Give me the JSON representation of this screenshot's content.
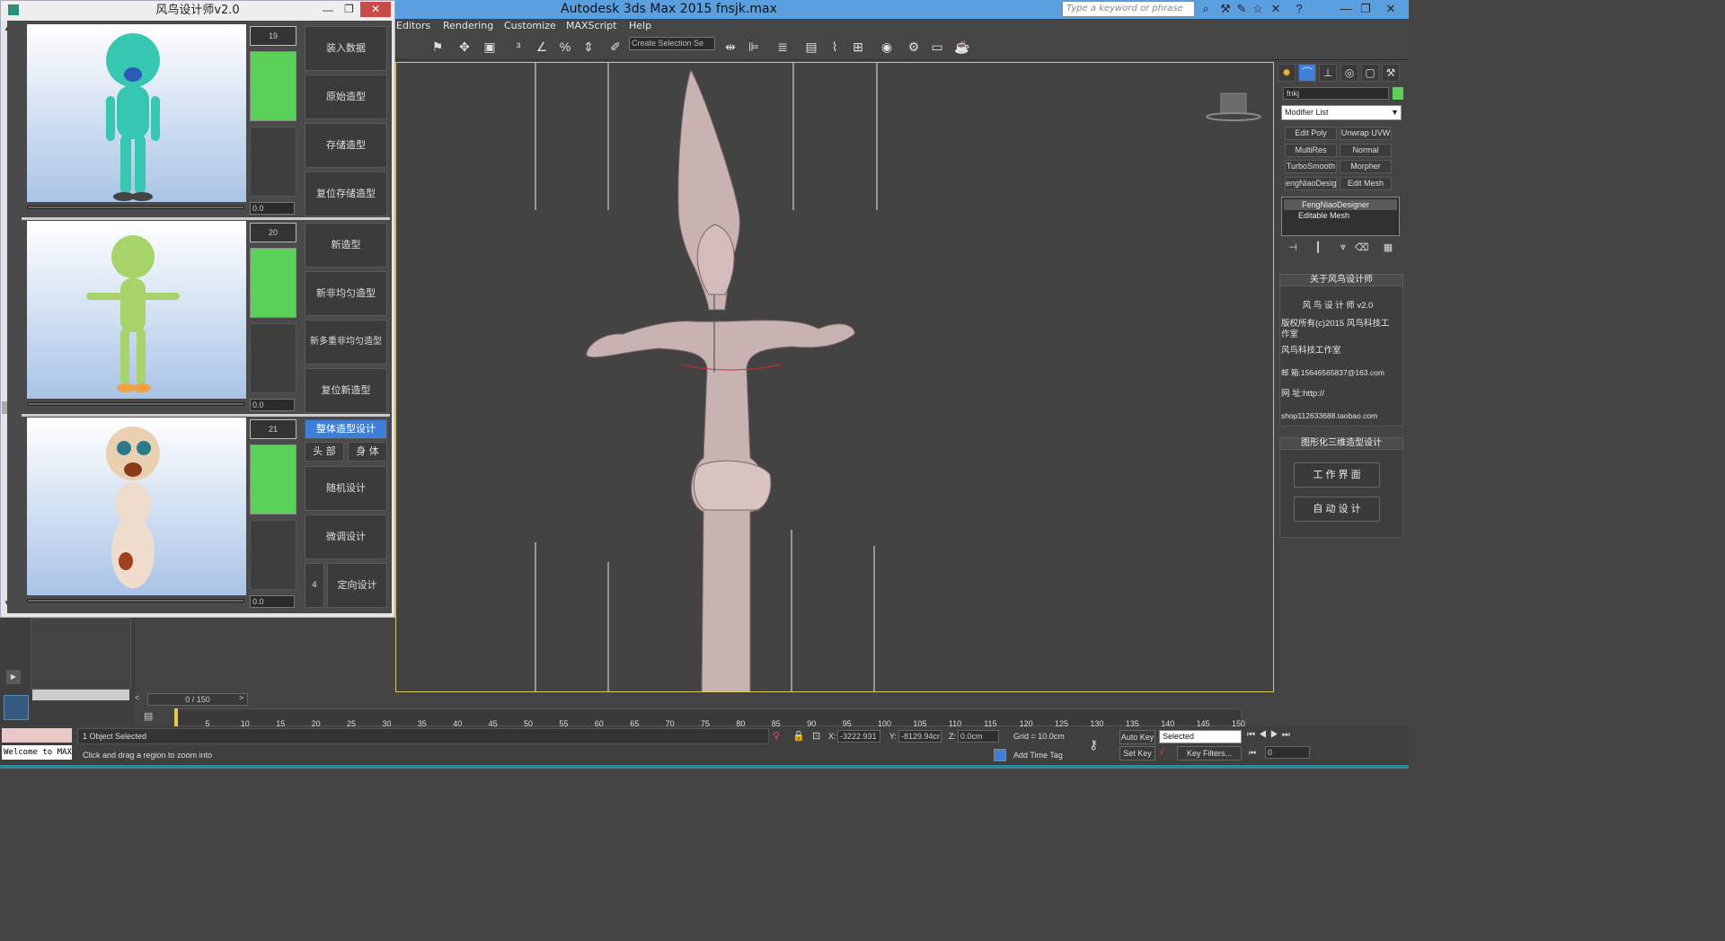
{
  "app": {
    "title": "Autodesk 3ds Max  2015     fnsjk.max",
    "search_placeholder": "Type a keyword or phrase",
    "menu": [
      "Editors",
      "Rendering",
      "Customize",
      "MAXScript",
      "Help"
    ],
    "selection_set_placeholder": "Create Selection Se"
  },
  "plugin": {
    "title": "风鸟设计师v2.0",
    "rows": [
      {
        "index": "19",
        "spin": "0.0",
        "buttons": [
          "装入数据",
          "原始造型",
          "存储造型",
          "复位存储造型"
        ]
      },
      {
        "index": "20",
        "spin": "0.0",
        "buttons": [
          "新造型",
          "新非均匀造型",
          "新多重非均匀造型",
          "复位新造型"
        ]
      },
      {
        "index": "21",
        "spin": "0.0",
        "active_button": "整体造型设计",
        "sub_buttons": [
          "头 部",
          "身 体"
        ],
        "buttons": [
          "随机设计",
          "微调设计"
        ],
        "directional_value": "4",
        "directional_button": "定向设计"
      }
    ],
    "colors": {
      "slot_green": "#5ad25a",
      "active_blue": "#3d7fd6"
    }
  },
  "right_panel": {
    "object_name": "fnkj",
    "object_color": "#5ad25a",
    "modifier_list": "Modifier List",
    "modifier_buttons": [
      "Edit Poly",
      "Unwrap UVW",
      "MultiRes",
      "Normal",
      "TurboSmooth",
      "Morpher",
      "engNiaoDesign",
      "Edit Mesh"
    ],
    "stack": [
      "FengNiaoDesigner",
      "Editable Mesh"
    ],
    "about": {
      "header": "关于风鸟设计师",
      "lines": [
        "风 鸟 设 计 师 v2.0",
        "版权所有(c)2015 风鸟科技工作室",
        "风鸟科技工作室",
        "邮 箱:15646565837@163.com",
        "网 址:http://",
        "shop112633688.taobao.com"
      ]
    },
    "design": {
      "header": "图形化三维造型设计",
      "buttons": [
        "工 作 界 面",
        "自 动 设 计"
      ]
    }
  },
  "timeline": {
    "frame_counter": "0 / 150",
    "ticks": [
      "5",
      "10",
      "15",
      "20",
      "25",
      "30",
      "35",
      "40",
      "45",
      "50",
      "55",
      "60",
      "65",
      "70",
      "75",
      "80",
      "85",
      "90",
      "95",
      "100",
      "105",
      "110",
      "115",
      "120",
      "125",
      "130",
      "135",
      "140",
      "145",
      "150"
    ]
  },
  "status": {
    "welcome": "Welcome to MAX",
    "selected": "1 Object Selected",
    "prompt": "Click and drag a region to zoom into",
    "x_label": "X:",
    "x": "-3222.931",
    "y_label": "Y:",
    "y": "-8129.94cr",
    "z_label": "Z:",
    "z": "0.0cm",
    "grid": "Grid = 10.0cm",
    "auto_key": "Auto Key",
    "set_key": "Set Key",
    "key_mode": "Selected",
    "key_filters": "Key Filters...",
    "add_time_tag": "Add Time Tag",
    "frame": "0"
  }
}
